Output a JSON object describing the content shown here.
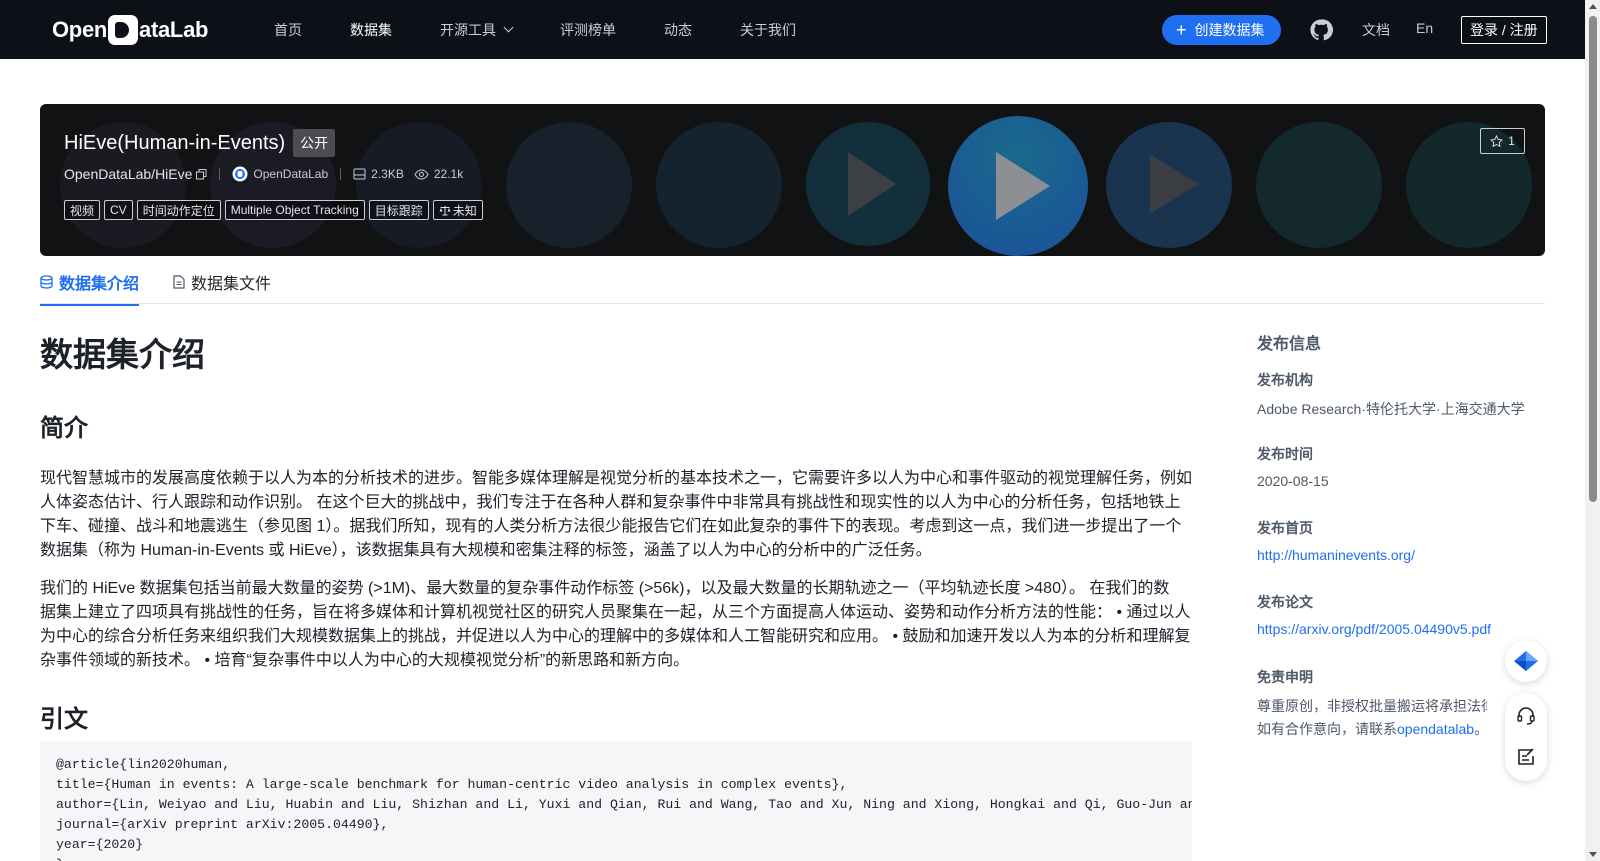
{
  "nav": {
    "logo_left": "Open",
    "logo_right": "ataLab",
    "links": [
      "首页",
      "数据集",
      "开源工具",
      "评测榜单",
      "动态",
      "关于我们"
    ],
    "create_label": "创建数据集",
    "docs": "文档",
    "lang": "En",
    "login": "登录 / 注册"
  },
  "hero": {
    "title": "HiEve(Human-in-Events)",
    "visibility": "公开",
    "repo": "OpenDataLab/HiEve",
    "org": "OpenDataLab",
    "size": "2.3KB",
    "views": "22.1k",
    "tags": [
      "视频",
      "CV",
      "时间动作定位",
      "Multiple Object Tracking",
      "目标跟踪"
    ],
    "license": "未知",
    "stars": "1"
  },
  "tabs": [
    "数据集介绍",
    "数据集文件"
  ],
  "main": {
    "title": "数据集介绍",
    "intro_heading": "简介",
    "para1": [
      "现代智慧城市的发展高度依赖于以人为本的分析技术的进步。智能多媒体理解是视觉分析的基本技术之一，它需要许多以人为中心和事件驱动的视觉理解任务，例如",
      "人体姿态估计、行人跟踪和动作识别。 在这个巨大的挑战中，我们专注于在各种人群和复杂事件中非常具有挑战性和现实性的以人为中心的分析任务，包括地铁上",
      "下车、碰撞、战斗和地震逃生（参见图 1）。据我们所知，现有的人类分析方法很少能报告它们在如此复杂的事件下的表现。考虑到这一点，我们进一步提出了一个",
      "数据集（称为 Human-in-Events 或 HiEve），该数据集具有大规模和密集注释的标签，涵盖了以人为中心的分析中的广泛任务。"
    ],
    "para2": [
      "我们的 HiEve 数据集包括当前最大数量的姿势 (>1M)、最大数量的复杂事件动作标签 (>56k)，以及最大数量的长期轨迹之一（平均轨迹长度 >480）。 在我们的数",
      "据集上建立了四项具有挑战性的任务，旨在将多媒体和计算机视觉社区的研究人员聚集在一起，从三个方面提高人体运动、姿势和动作分析方法的性能： • 通过以人",
      "为中心的综合分析任务来组织我们大规模数据集上的挑战，并促进以人为中心的理解中的多媒体和人工智能研究和应用。 • 鼓励和加速开发以人为本的分析和理解复",
      "杂事件领域的新技术。 • 培育“复杂事件中以人为中心的大规模视觉分析”的新思路和新方向。"
    ],
    "cite_heading": "引文",
    "citation": [
      "@article{lin2020human,",
      "title={Human in events: A large-scale benchmark for human-centric video analysis in complex events},",
      "author={Lin, Weiyao and Liu, Huabin and Liu, Shizhan and Li, Yuxi and Qian, Rui and Wang, Tao and Xu, Ning and Xiong, Hongkai and Qi, Guo-Jun and Sebe, Nicu},",
      "journal={arXiv preprint arXiv:2005.04490},",
      "year={2020}",
      "}"
    ]
  },
  "side": {
    "title": "发布信息",
    "org_label": "发布机构",
    "org_value": "Adobe Research·特伦托大学·上海交通大学",
    "date_label": "发布时间",
    "date_value": "2020-08-15",
    "home_label": "发布首页",
    "home_value": "http://humaninevents.org/",
    "paper_label": "发布论文",
    "paper_value": "https://arxiv.org/pdf/2005.04490v5.pdf",
    "disclaimer_label": "免责申明",
    "disclaimer_line1": "尊重原创，非授权批量搬运将承担法律责任",
    "disclaimer_line2_prefix": "如有合作意向，请联系",
    "disclaimer_link": "opendatalab",
    "disclaimer_suffix": "。"
  },
  "colors": {
    "accent": "#1f6ff0",
    "nav_bg": "#0d1117",
    "hero_bg": "#111214"
  },
  "icons": [
    "plus-icon",
    "chevron-down-icon",
    "github-icon",
    "copy-icon",
    "org-logo-icon",
    "storage-icon",
    "eye-icon",
    "scale-icon",
    "star-icon",
    "database-icon",
    "file-icon",
    "diamond-icon",
    "headset-icon",
    "feedback-icon"
  ]
}
